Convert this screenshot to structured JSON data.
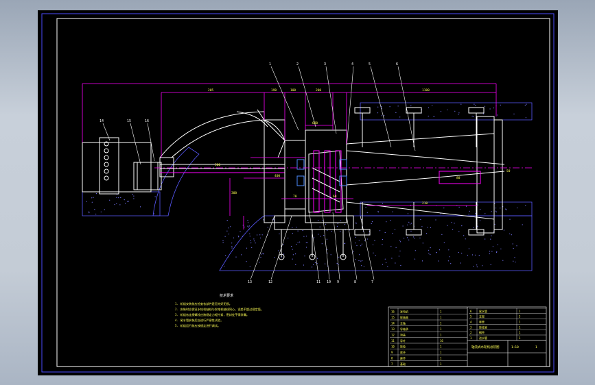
{
  "drawing": {
    "leader_labels_top": [
      "1",
      "2",
      "3",
      "4",
      "5",
      "6"
    ],
    "leader_labels_bottom": [
      "13",
      "12",
      "11",
      "10",
      "9",
      "8",
      "7"
    ],
    "leader_labels_left": [
      "14",
      "15",
      "16"
    ],
    "dimension_labels": [
      "205",
      "190",
      "100",
      "200",
      "1100",
      "600",
      "500",
      "400",
      "300",
      "70",
      "60",
      "80",
      "210",
      "50"
    ],
    "notes_heading": "技术要求",
    "notes": [
      "1. 机组安装前应检查各部件是否完好无损。",
      "2. 安装时应保证水轮机轴线与发电机轴线同心，误差不超过规定值。",
      "3. 机组各连接螺栓应按规定力矩拧紧，密封处不得渗漏。",
      "4. 尾水管安装后应进行严密性试验。",
      "5. 机组运行前应按规定进行调试。"
    ]
  },
  "title_block": {
    "drawing_title": "轴流式水轮机总装图",
    "scale": "1:10",
    "sheet": "1",
    "parts_left": [
      {
        "no": "16",
        "name": "发电机",
        "qty": "1"
      },
      {
        "no": "15",
        "name": "联轴器",
        "qty": "1"
      },
      {
        "no": "14",
        "name": "主轴",
        "qty": "1"
      },
      {
        "no": "13",
        "name": "导轴承",
        "qty": "1"
      },
      {
        "no": "12",
        "name": "顶盖",
        "qty": "1"
      },
      {
        "no": "11",
        "name": "导叶",
        "qty": "16"
      },
      {
        "no": "10",
        "name": "转轮",
        "qty": "1"
      },
      {
        "no": "9",
        "name": "底环",
        "qty": "1"
      },
      {
        "no": "8",
        "name": "座环",
        "qty": "1"
      },
      {
        "no": "7",
        "name": "基础",
        "qty": "1"
      }
    ],
    "parts_right": [
      {
        "no": "6",
        "name": "尾水管",
        "qty": "1"
      },
      {
        "no": "5",
        "name": "支架",
        "qty": "3"
      },
      {
        "no": "4",
        "name": "锥管",
        "qty": "1"
      },
      {
        "no": "3",
        "name": "转轮室",
        "qty": "1"
      },
      {
        "no": "2",
        "name": "蜗壳",
        "qty": "1"
      },
      {
        "no": "1",
        "name": "进水管",
        "qty": "1"
      }
    ]
  }
}
